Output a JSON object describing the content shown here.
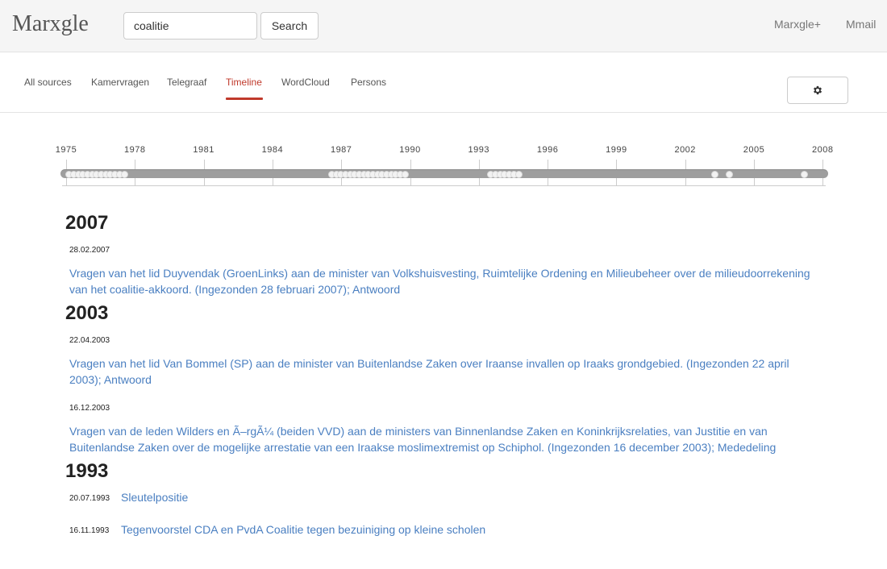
{
  "app": {
    "logo": "Marxgle"
  },
  "search": {
    "value": "coalitie",
    "button_label": "Search"
  },
  "top_links": {
    "marxgle_plus": "Marxgle+",
    "mmail": "Mmail"
  },
  "tabs": [
    {
      "label": "All sources",
      "active": false
    },
    {
      "label": "Kamervragen",
      "active": false
    },
    {
      "label": "Telegraaf",
      "active": false
    },
    {
      "label": "Timeline",
      "active": true
    },
    {
      "label": "WordCloud",
      "active": false
    },
    {
      "label": "Persons",
      "active": false
    }
  ],
  "settings": {
    "icon": "gear-icon"
  },
  "timeline": {
    "years": [
      "1975",
      "1978",
      "1981",
      "1984",
      "1987",
      "1990",
      "1993",
      "1996",
      "1999",
      "2002",
      "2005",
      "2008"
    ],
    "markers": [
      1975.15,
      1975.35,
      1975.55,
      1975.75,
      1975.95,
      1976.15,
      1976.35,
      1976.55,
      1976.75,
      1976.95,
      1977.15,
      1977.35,
      1977.55,
      1986.6,
      1986.8,
      1987.0,
      1987.2,
      1987.4,
      1987.6,
      1987.8,
      1988.0,
      1988.2,
      1988.4,
      1988.6,
      1988.8,
      1989.0,
      1989.2,
      1989.4,
      1989.6,
      1989.8,
      1993.55,
      1993.75,
      1993.95,
      1994.15,
      1994.35,
      1994.55,
      1994.75,
      2003.3,
      2003.95,
      2007.2
    ]
  },
  "results": [
    {
      "type": "year",
      "label": "2007"
    },
    {
      "type": "date",
      "label": "28.02.2007"
    },
    {
      "type": "link",
      "label": "Vragen van het lid Duyvendak (GroenLinks) aan de minister van Volkshuisvesting, Ruimtelijke Ordening en Milieubeheer over de milieudoorrekening van het coalitie-akkoord. (Ingezonden 28 februari 2007); Antwoord"
    },
    {
      "type": "year",
      "label": "2003"
    },
    {
      "type": "date",
      "label": "22.04.2003"
    },
    {
      "type": "link",
      "label": "Vragen van het lid Van Bommel (SP) aan de minister van Buitenlandse Zaken over Iraanse invallen op Iraaks grondgebied. (Ingezonden 22 april 2003); Antwoord"
    },
    {
      "type": "date",
      "label": "16.12.2003"
    },
    {
      "type": "link",
      "label": "Vragen van de leden Wilders en Ã–rgÃ¼ (beiden VVD) aan de ministers van Binnenlandse Zaken en Koninkrijksrelaties, van Justitie en van Buitenlandse Zaken over de mogelijke arrestatie van een Iraakse moslimextremist op Schiphol. (Ingezonden 16 december 2003); Mededeling"
    },
    {
      "type": "year",
      "label": "1993"
    },
    {
      "type": "date",
      "label": "20.07.1993"
    },
    {
      "type": "link",
      "label": "Sleutelpositie"
    },
    {
      "type": "date",
      "label": "16.11.1993"
    },
    {
      "type": "link",
      "label": "Tegenvoorstel CDA en PvdA Coalitie tegen bezuiniging op kleine scholen"
    }
  ]
}
